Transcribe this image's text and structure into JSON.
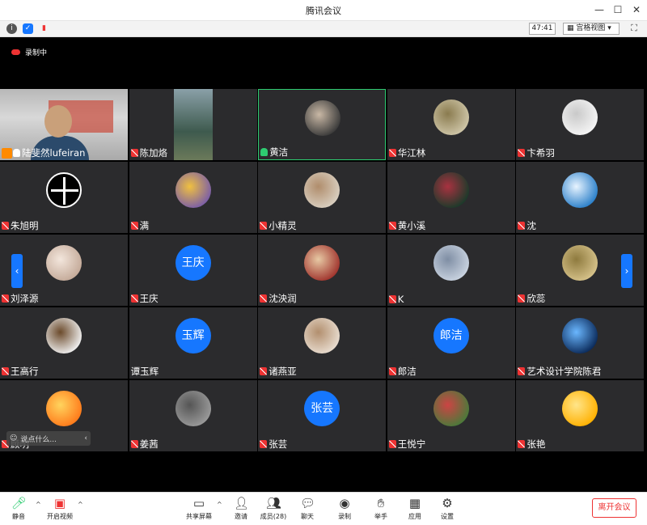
{
  "window": {
    "title": "腾讯会议"
  },
  "toolbar": {
    "timer": "47:41",
    "view_mode": "宫格视图"
  },
  "recording": {
    "label": "录制中"
  },
  "participants": [
    {
      "name": "陆斐然lufeiran",
      "mic": "on-white",
      "avatar": "video"
    },
    {
      "name": "陈加烙",
      "mic": "muted",
      "avatar": "image-strip"
    },
    {
      "name": "黄洁",
      "mic": "on",
      "avatar": "photo",
      "active": true
    },
    {
      "name": "华江林",
      "mic": "muted",
      "avatar": "photo"
    },
    {
      "name": "卞希羽",
      "mic": "muted",
      "avatar": "photo"
    },
    {
      "name": "朱旭明",
      "mic": "muted",
      "avatar": "logo"
    },
    {
      "name": "满",
      "mic": "muted",
      "avatar": "photo"
    },
    {
      "name": "小精灵",
      "mic": "muted",
      "avatar": "photo"
    },
    {
      "name": "黄小溪",
      "mic": "muted",
      "avatar": "photo"
    },
    {
      "name": "沈",
      "mic": "muted",
      "avatar": "photo"
    },
    {
      "name": "刘泽源",
      "mic": "muted",
      "avatar": "photo"
    },
    {
      "name": "王庆",
      "mic": "muted",
      "avatar": "initials",
      "initials": "王庆"
    },
    {
      "name": "沈泱润",
      "mic": "muted",
      "avatar": "photo"
    },
    {
      "name": "K",
      "mic": "muted",
      "avatar": "photo"
    },
    {
      "name": "欣蕊",
      "mic": "muted",
      "avatar": "photo"
    },
    {
      "name": "王高行",
      "mic": "muted",
      "avatar": "photo"
    },
    {
      "name": "谭玉辉",
      "mic": "none",
      "avatar": "initials",
      "initials": "玉辉"
    },
    {
      "name": "诸燕亚",
      "mic": "muted",
      "avatar": "photo"
    },
    {
      "name": "郎洁",
      "mic": "muted",
      "avatar": "initials",
      "initials": "郎洁"
    },
    {
      "name": "艺术设计学院陈君",
      "mic": "muted",
      "avatar": "photo"
    },
    {
      "name": "顾明",
      "mic": "muted",
      "avatar": "photo"
    },
    {
      "name": "姜茜",
      "mic": "muted",
      "avatar": "photo"
    },
    {
      "name": "张芸",
      "mic": "muted",
      "avatar": "initials",
      "initials": "张芸"
    },
    {
      "name": "王悦宁",
      "mic": "muted",
      "avatar": "photo"
    },
    {
      "name": "张艳",
      "mic": "muted",
      "avatar": "photo"
    }
  ],
  "chat": {
    "placeholder": "说点什么..."
  },
  "bottom": {
    "mute": "静音",
    "video": "开启视频",
    "share": "共享屏幕",
    "invite": "邀请",
    "members": "成员(28)",
    "chat": "聊天",
    "record": "录制",
    "raise_hand": "举手",
    "apps": "应用",
    "settings": "设置",
    "leave": "离开会议"
  },
  "colors": {
    "accent": "#1677ff",
    "danger": "#e53935",
    "speaking": "#2ecc71",
    "tile": "#2b2b2d"
  }
}
